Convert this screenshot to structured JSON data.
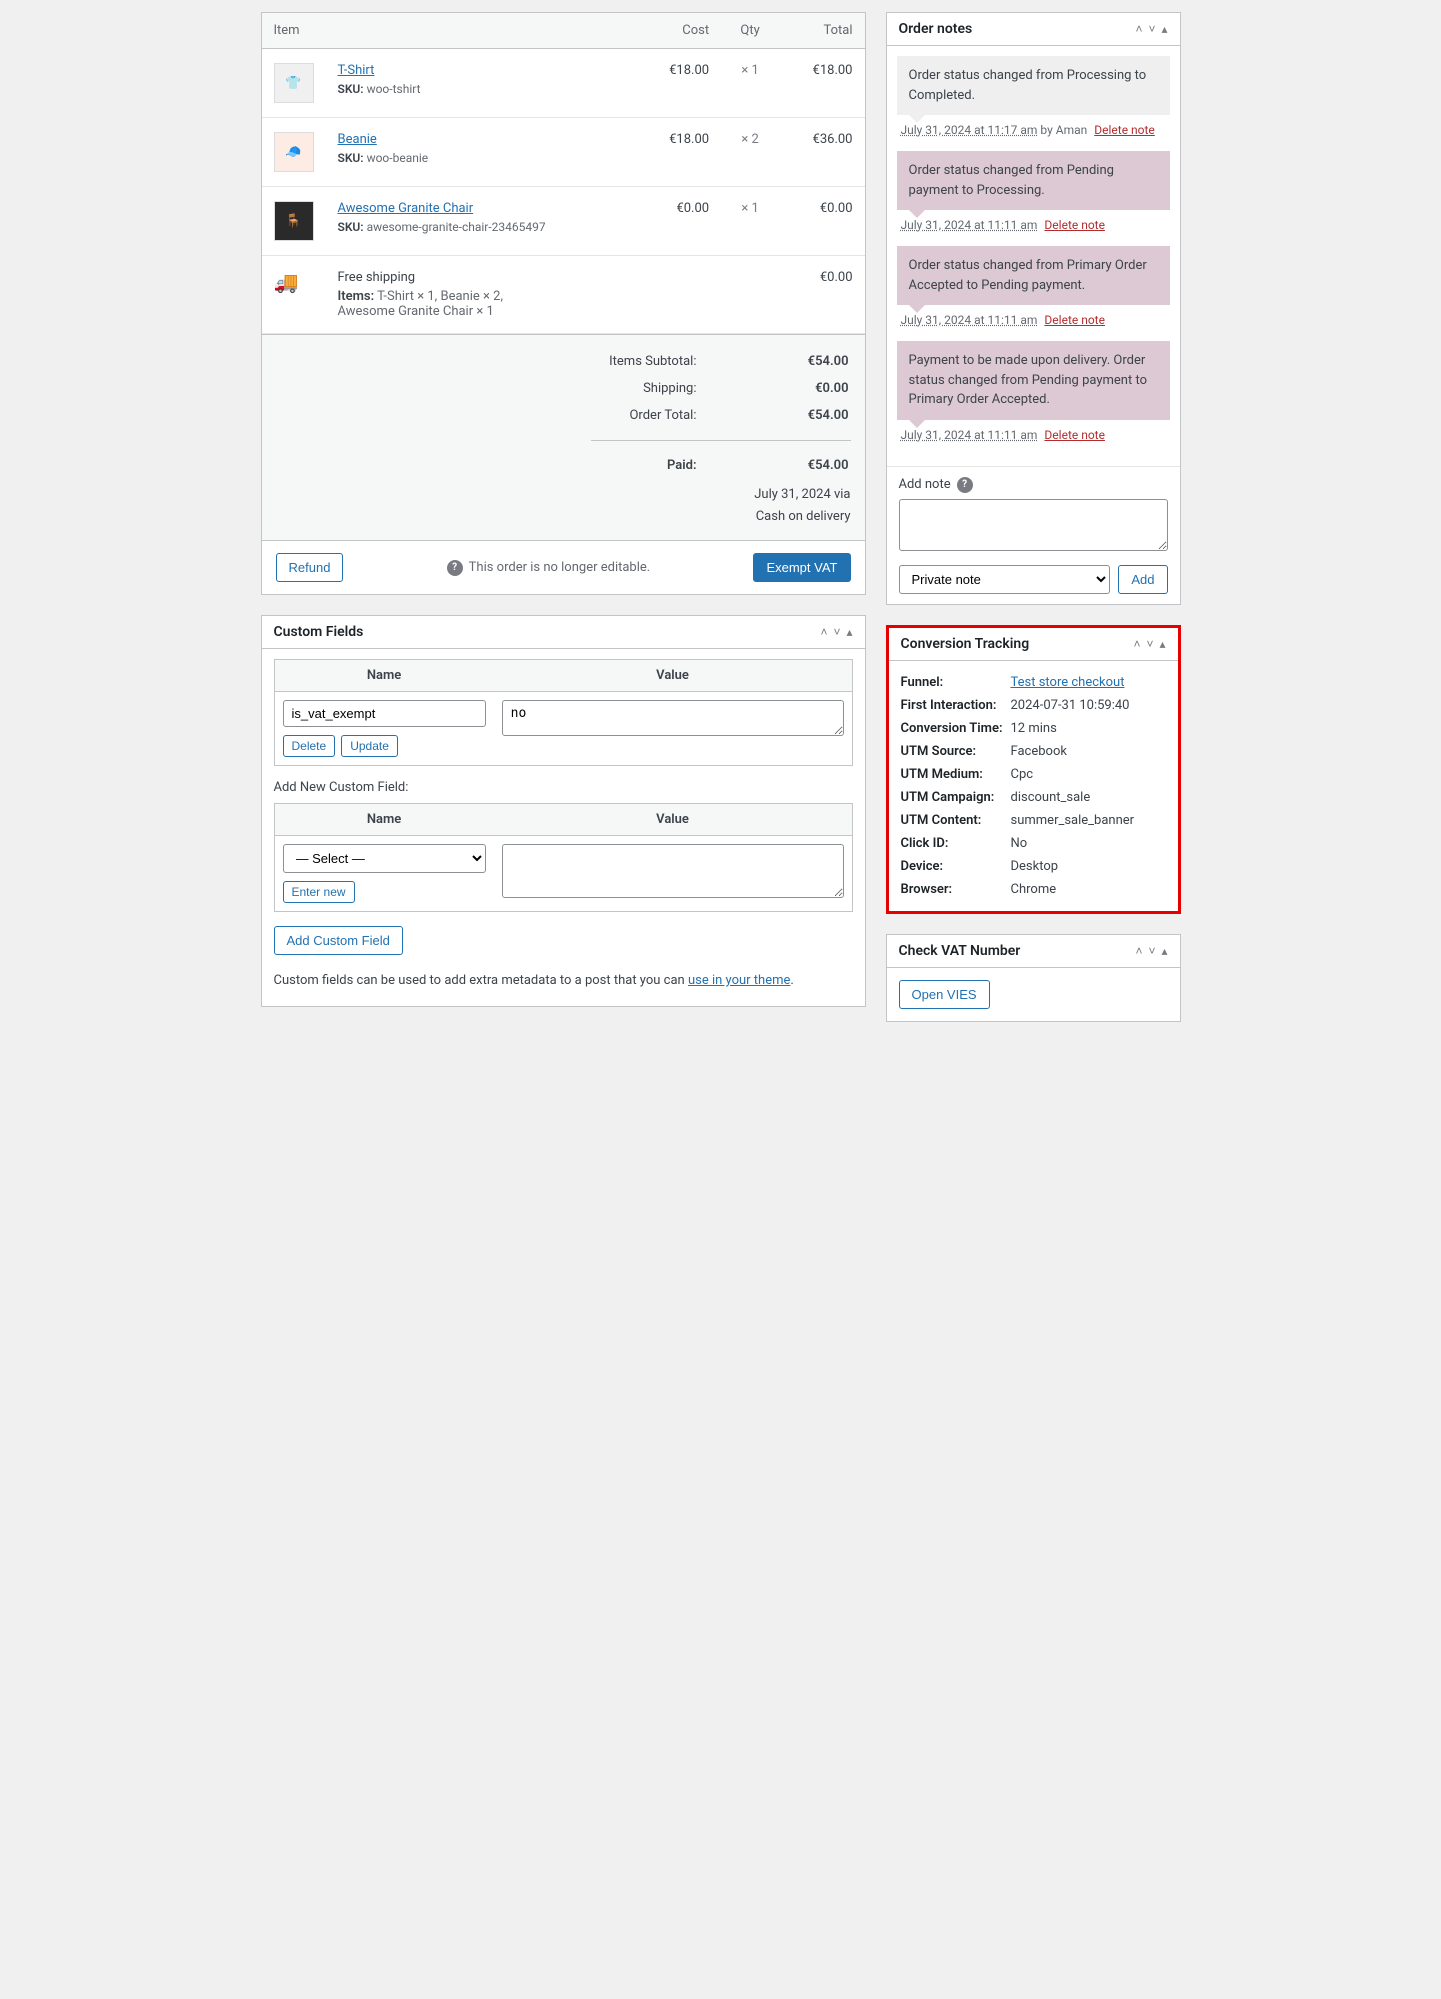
{
  "items_header": {
    "item": "Item",
    "cost": "Cost",
    "qty": "Qty",
    "total": "Total"
  },
  "line_items": [
    {
      "name": "T-Shirt",
      "sku_label": "SKU:",
      "sku": "woo-tshirt",
      "cost": "€18.00",
      "qty": "× 1",
      "total": "€18.00"
    },
    {
      "name": "Beanie",
      "sku_label": "SKU:",
      "sku": "woo-beanie",
      "cost": "€18.00",
      "qty": "× 2",
      "total": "€36.00"
    },
    {
      "name": "Awesome Granite Chair",
      "sku_label": "SKU:",
      "sku": "awesome-granite-chair-23465497",
      "cost": "€0.00",
      "qty": "× 1",
      "total": "€0.00"
    }
  ],
  "shipping": {
    "name": "Free shipping",
    "items_label": "Items:",
    "items": "T-Shirt × 1, Beanie × 2, Awesome Granite Chair × 1",
    "total": "€0.00"
  },
  "totals": {
    "subtotal_label": "Items Subtotal:",
    "subtotal": "€54.00",
    "shipping_label": "Shipping:",
    "shipping": "€0.00",
    "order_total_label": "Order Total:",
    "order_total": "€54.00",
    "paid_label": "Paid:",
    "paid": "€54.00",
    "paid_date": "July 31, 2024 via",
    "paid_method": "Cash on delivery"
  },
  "actions": {
    "refund": "Refund",
    "no_edit": "This order is no longer editable.",
    "exempt_vat": "Exempt VAT"
  },
  "notes_panel": {
    "title": "Order notes",
    "notes": [
      {
        "text": "Order status changed from Processing to Completed.",
        "ts": "July 31, 2024 at 11:17 am",
        "by": "by Aman",
        "delete": "Delete note",
        "sys": false
      },
      {
        "text": "Order status changed from Pending payment to Processing.",
        "ts": "July 31, 2024 at 11:11 am",
        "by": "",
        "delete": "Delete note",
        "sys": true
      },
      {
        "text": "Order status changed from Primary Order Accepted to Pending payment.",
        "ts": "July 31, 2024 at 11:11 am",
        "by": "",
        "delete": "Delete note",
        "sys": true
      },
      {
        "text": "Payment to be made upon delivery. Order status changed from Pending payment to Primary Order Accepted.",
        "ts": "July 31, 2024 at 11:11 am",
        "by": "",
        "delete": "Delete note",
        "sys": true
      }
    ],
    "add_label": "Add note",
    "type_selected": "Private note",
    "add_btn": "Add"
  },
  "conversion": {
    "title": "Conversion Tracking",
    "rows": [
      {
        "k": "Funnel:",
        "v": "Test store checkout",
        "link": true
      },
      {
        "k": "First Interaction:",
        "v": "2024-07-31 10:59:40"
      },
      {
        "k": "Conversion Time:",
        "v": "12 mins"
      },
      {
        "k": "UTM Source:",
        "v": "Facebook"
      },
      {
        "k": "UTM Medium:",
        "v": "Cpc"
      },
      {
        "k": "UTM Campaign:",
        "v": "discount_sale"
      },
      {
        "k": "UTM Content:",
        "v": "summer_sale_banner"
      },
      {
        "k": "Click ID:",
        "v": "No"
      },
      {
        "k": "Device:",
        "v": "Desktop"
      },
      {
        "k": "Browser:",
        "v": "Chrome"
      }
    ]
  },
  "vat_panel": {
    "title": "Check VAT Number",
    "open": "Open VIES"
  },
  "custom_fields": {
    "title": "Custom Fields",
    "name_h": "Name",
    "value_h": "Value",
    "rows": [
      {
        "name": "is_vat_exempt",
        "value": "no"
      }
    ],
    "delete": "Delete",
    "update": "Update",
    "add_heading": "Add New Custom Field:",
    "select_placeholder": "— Select —",
    "enter_new": "Enter new",
    "add_btn": "Add Custom Field",
    "hint_pre": "Custom fields can be used to add extra metadata to a post that you can ",
    "hint_link": "use in your theme",
    "hint_post": "."
  }
}
